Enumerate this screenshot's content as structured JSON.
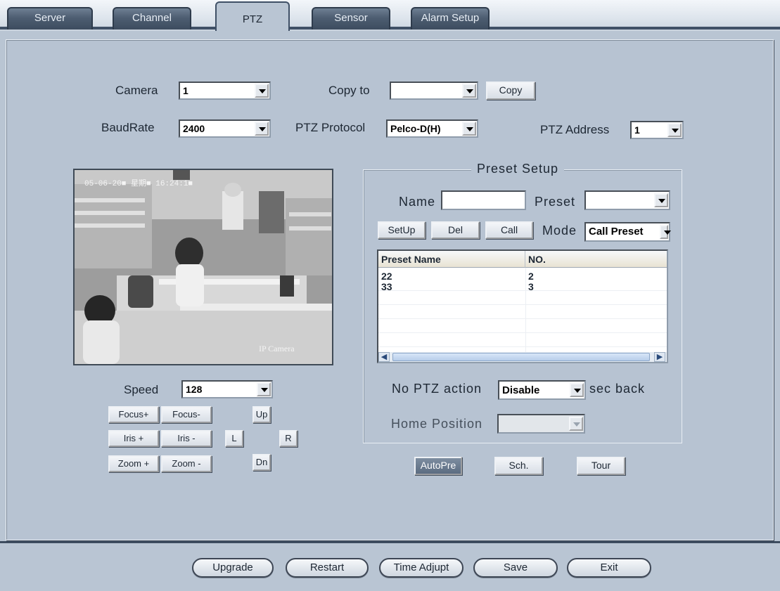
{
  "tabs": [
    "Server",
    "Channel",
    "PTZ",
    "Sensor",
    "Alarm Setup"
  ],
  "camera": {
    "label": "Camera",
    "value": "1"
  },
  "copy_to": {
    "label": "Copy to",
    "value": "",
    "button": "Copy"
  },
  "baud_rate": {
    "label": "BaudRate",
    "value": "2400"
  },
  "ptz_protocol": {
    "label": "PTZ Protocol",
    "value": "Pelco-D(H)"
  },
  "ptz_address": {
    "label": "PTZ Address",
    "value": "1"
  },
  "video": {
    "overlay_time": "05-06-20■ 星期■ 16:24:1■",
    "overlay_name": "IP Camera"
  },
  "speed": {
    "label": "Speed",
    "value": "128"
  },
  "ptz_buttons": {
    "focus_plus": "Focus+",
    "focus_minus": "Focus-",
    "iris_plus": "Iris +",
    "iris_minus": "Iris -",
    "zoom_plus": "Zoom +",
    "zoom_minus": "Zoom -",
    "up": "Up",
    "down": "Dn",
    "left": "L",
    "right": "R"
  },
  "preset_setup": {
    "title": "Preset Setup",
    "name_label": "Name",
    "name_value": "",
    "preset_label": "Preset",
    "preset_value": "",
    "setup_btn": "SetUp",
    "del_btn": "Del",
    "call_btn": "Call",
    "mode_label": "Mode",
    "mode_value": "Call Preset",
    "columns": [
      "Preset Name",
      "NO."
    ],
    "rows": [
      {
        "name": "22",
        "no": "2"
      },
      {
        "name": "33",
        "no": "3"
      }
    ],
    "no_action_label": "No PTZ action",
    "no_action_value": "Disable",
    "sec_back": "sec back",
    "home_label": "Home Position",
    "home_value": ""
  },
  "mode_buttons": [
    "AutoPre",
    "Sch.",
    "Tour"
  ],
  "bottom_buttons": [
    "Upgrade",
    "Restart",
    "Time Adjupt",
    "Save",
    "Exit"
  ]
}
